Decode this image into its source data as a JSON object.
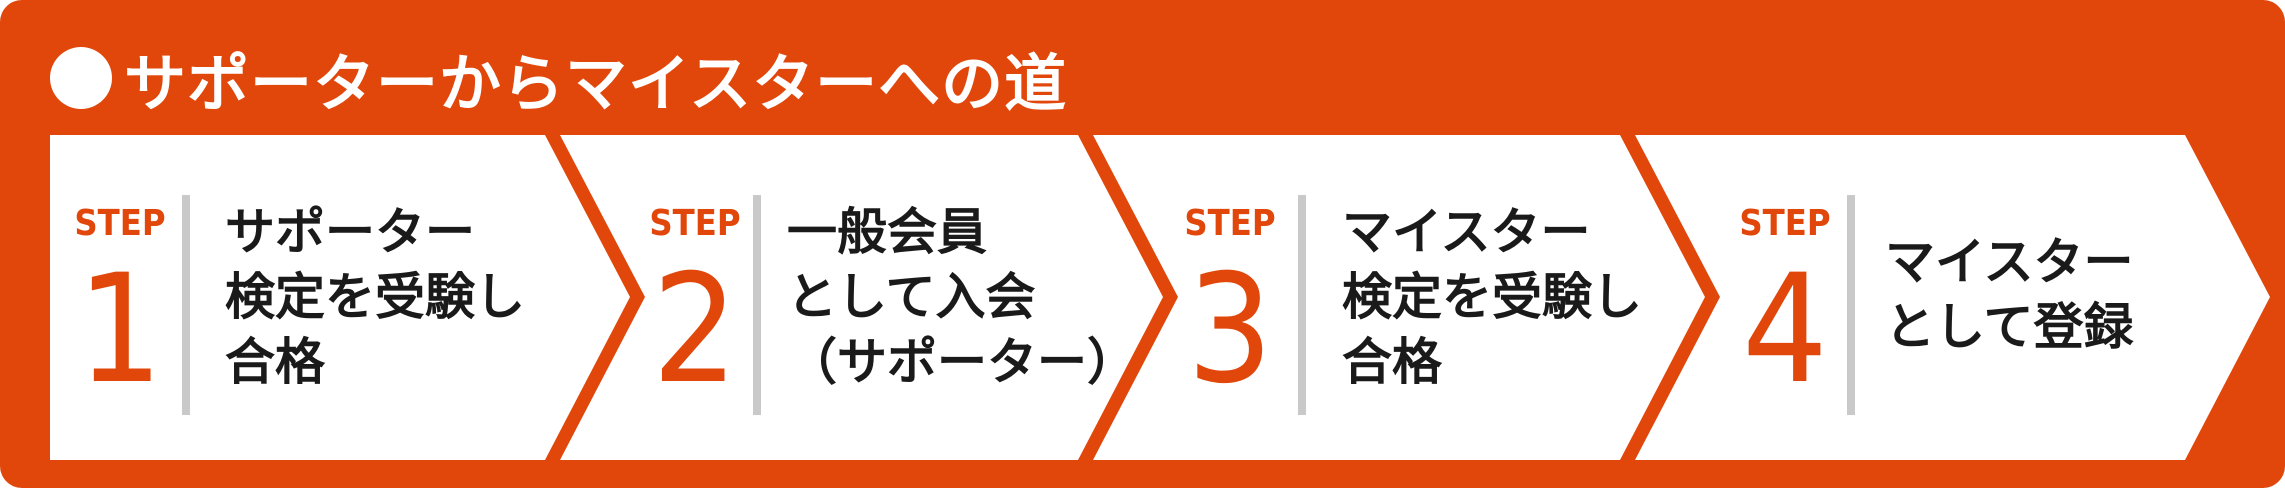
{
  "title": "サポーターからマイスターへの道",
  "colors": {
    "accent": "#e1470b",
    "panel": "#ffffff",
    "divider": "#c9c9c9",
    "text": "#1a1a1a"
  },
  "steps": [
    {
      "label": "STEP",
      "number": "1",
      "lines": [
        "サポーター",
        "検定を受験し",
        "合格"
      ]
    },
    {
      "label": "STEP",
      "number": "2",
      "lines": [
        "一般会員",
        "として入会",
        "（サポーター）"
      ]
    },
    {
      "label": "STEP",
      "number": "3",
      "lines": [
        "マイスター",
        "検定を受験し",
        "合格"
      ]
    },
    {
      "label": "STEP",
      "number": "4",
      "lines": [
        "マイスター",
        "として登録"
      ]
    }
  ]
}
